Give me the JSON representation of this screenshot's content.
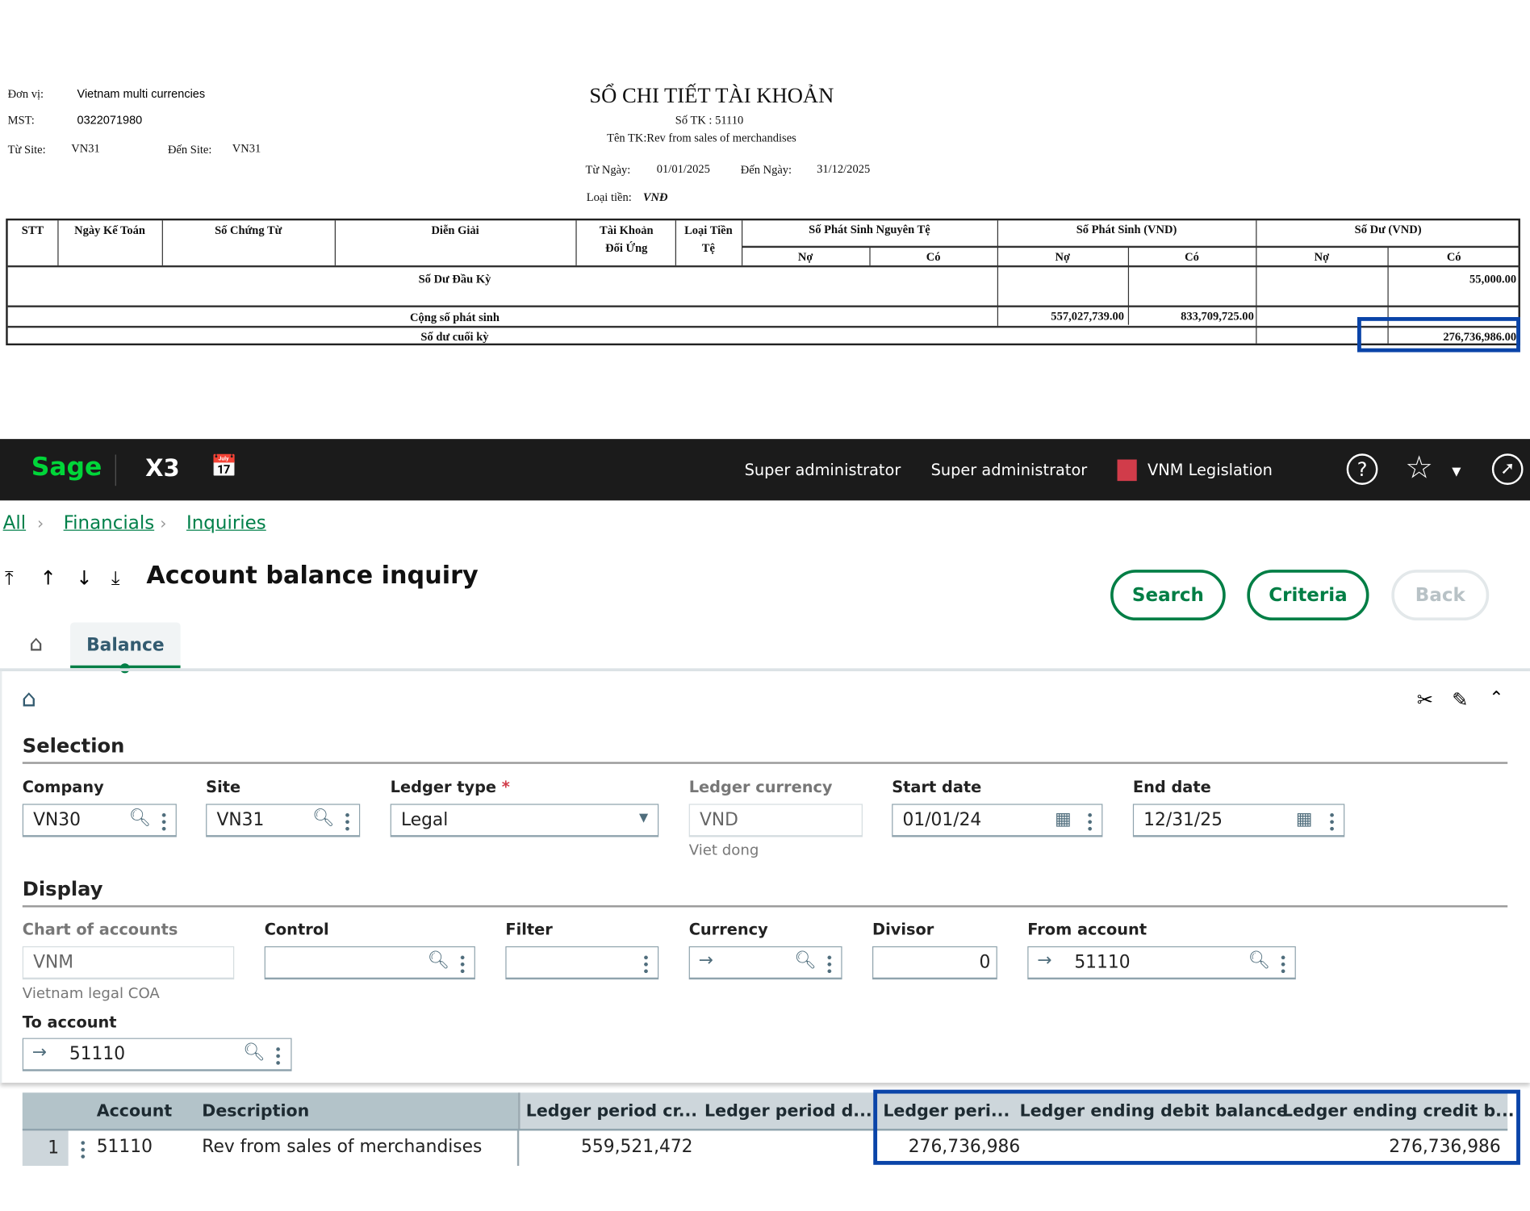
{
  "report": {
    "don_vi_label": "Đơn vị:",
    "don_vi": "Vietnam multi currencies",
    "mst_label": "MST:",
    "mst": "0322071980",
    "tu_site_label": "Từ Site:",
    "tu_site": "VN31",
    "den_site_label": "Đến Site:",
    "den_site": "VN31",
    "title": "SỔ CHI TIẾT TÀI KHOẢN",
    "so_tk": "Số TK  : 51110",
    "ten_tk": "Tên TK:Rev from sales of merchandises",
    "tu_ngay_label": "Từ Ngày:",
    "tu_ngay": "01/01/2025",
    "den_ngay_label": "Đến Ngày:",
    "den_ngay": "31/12/2025",
    "loai_tien_label": "Loại tiền:",
    "loai_tien": "VNĐ",
    "headers": [
      "STT",
      "Ngày Kế Toán",
      "Số Chứng Từ",
      "Diễn Giải",
      "Tài Khoản Đối Ứng",
      "Loại Tiền Tệ",
      "Số Phát Sinh Nguyên Tệ",
      "Số Phát Sinh (VND)",
      "Số Dư (VND)"
    ],
    "subheaders": [
      "Nợ",
      "Có",
      "Nợ",
      "Có",
      "Nợ",
      "Có"
    ],
    "opening_label": "Số Dư Đầu Kỳ",
    "opening_credit": "55,000.00",
    "total_label": "Cộng số phát sinh",
    "total_debit": "557,027,739.00",
    "total_credit": "833,709,725.00",
    "closing_label": "Số dư cuối kỳ",
    "closing_credit": "276,736,986.00"
  },
  "topbar": {
    "logo": "Sage",
    "product": "X3",
    "user1": "Super administrator",
    "user2": "Super administrator",
    "legislation": "VNM Legislation",
    "legislation_color": "#d13c4a"
  },
  "breadcrumb": [
    "All",
    "Financials",
    "Inquiries"
  ],
  "page": {
    "title": "Account balance inquiry",
    "search": "Search",
    "criteria": "Criteria",
    "back": "Back"
  },
  "tabs": {
    "balance": "Balance"
  },
  "selection": {
    "title": "Selection",
    "company_label": "Company",
    "company": "VN30",
    "site_label": "Site",
    "site": "VN31",
    "ledger_type_label": "Ledger type",
    "ledger_type": "Legal",
    "required": "*",
    "ledger_currency_label": "Ledger currency",
    "ledger_currency": "VND",
    "ledger_currency_desc": "Viet dong",
    "start_date_label": "Start date",
    "start_date": "01/01/24",
    "end_date_label": "End date",
    "end_date": "12/31/25"
  },
  "display": {
    "title": "Display",
    "coa_label": "Chart of accounts",
    "coa": "VNM",
    "coa_desc": "Vietnam legal COA",
    "control_label": "Control",
    "control": "",
    "filter_label": "Filter",
    "filter": "",
    "currency_label": "Currency",
    "currency": "",
    "divisor_label": "Divisor",
    "divisor": "0",
    "from_account_label": "From account",
    "from_account": "51110",
    "to_account_label": "To account",
    "to_account": "51110"
  },
  "grid": {
    "headers": [
      "Account",
      "Description",
      "Ledger period cr...",
      "Ledger period d...",
      "Ledger peri...",
      "Ledger ending debit balance",
      "Ledger ending credit b..."
    ],
    "rows": [
      {
        "num": "1",
        "account": "51110",
        "description": "Rev from sales of merchandises",
        "period_credit": "559,521,472",
        "period_debit": "",
        "period_balance": "276,736,986",
        "ending_debit": "",
        "ending_credit": "276,736,986"
      }
    ]
  },
  "colors": {
    "accent": "#007e45",
    "highlight_box": "#0a44a8"
  }
}
